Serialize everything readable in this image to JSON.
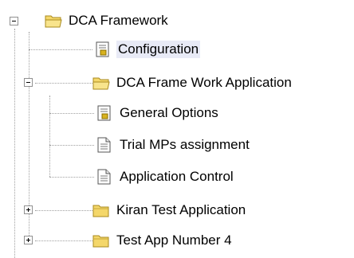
{
  "tree": {
    "root": {
      "label": "DCA Framework",
      "icon": "open-folder-icon",
      "state": "expanded"
    },
    "configuration": {
      "label": "Configuration",
      "icon": "config-document-icon",
      "selected": true
    },
    "app_folder": {
      "label": "DCA Frame Work Application",
      "icon": "open-folder-icon",
      "state": "expanded"
    },
    "general_options": {
      "label": "General Options",
      "icon": "config-document-icon"
    },
    "trial_mps": {
      "label": "Trial MPs assignment",
      "icon": "document-icon"
    },
    "application_control": {
      "label": "Application Control",
      "icon": "document-icon"
    },
    "kiran_test": {
      "label": "Kiran Test Application",
      "icon": "closed-folder-icon",
      "state": "collapsed"
    },
    "test_app_4": {
      "label": "Test App Number 4",
      "icon": "closed-folder-icon",
      "state": "collapsed"
    }
  },
  "colors": {
    "folder": "#f4d76a",
    "folder_edge": "#a88a1e",
    "selection": "#e8eaf6",
    "tree_line": "#a0a0a0"
  }
}
